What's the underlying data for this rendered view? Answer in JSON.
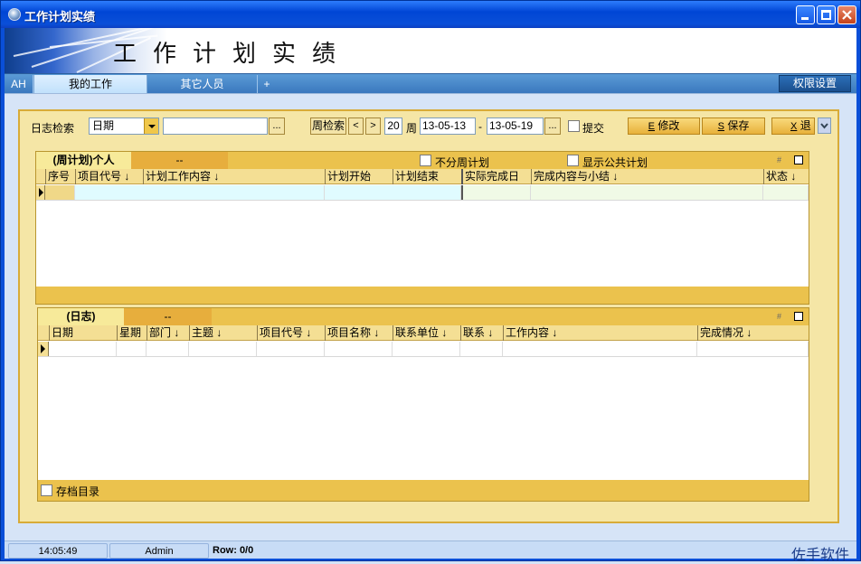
{
  "window": {
    "title": "工作计划实绩"
  },
  "banner": {
    "title": "工作计划实绩"
  },
  "tabs": {
    "ah": "AH",
    "my_work": "我的工作",
    "others": "其它人员",
    "add": "+",
    "permission": "权限设置"
  },
  "toolbar": {
    "log_search_label": "日志检索",
    "date_combo_value": "日期",
    "search_input_value": "",
    "ellipsis": "...",
    "week_search_label": "周检索",
    "prev": "<",
    "next": ">",
    "week_number": "20",
    "week_label": "周",
    "date_from": "13-05-13",
    "dash": "-",
    "date_to": "13-05-19",
    "submit_label": "提交",
    "edit_key": "E",
    "edit_label": "修改",
    "save_key": "S",
    "save_label": "保存",
    "exit_key": "X",
    "exit_label": "退"
  },
  "weekly_plan": {
    "tab_title": "(周计划)个人",
    "tab_sub": "--",
    "no_weekly_plan": "不分周计划",
    "show_public_plan": "显示公共计划",
    "columns": [
      "序号",
      "项目代号 ↓",
      "计划工作内容 ↓",
      "计划开始",
      "计划结束",
      "实际完成日",
      "完成内容与小结 ↓",
      "状态 ↓"
    ]
  },
  "daily_log": {
    "tab_title": "(日志)",
    "tab_sub": "--",
    "columns": [
      "日期",
      "星期",
      "部门 ↓",
      "主题 ↓",
      "项目代号 ↓",
      "项目名称 ↓",
      "联系单位 ↓",
      "联系 ↓",
      "工作内容 ↓",
      "完成情况 ↓"
    ],
    "archive_label": "存档目录"
  },
  "status": {
    "time": "14:05:49",
    "user": "Admin",
    "row": "Row: 0/0",
    "brand": "佐手软件"
  },
  "colors": {
    "title_blue": "#0a4fd8",
    "panel_yellow": "#f5e6a6",
    "header_gold": "#ebc24d"
  }
}
